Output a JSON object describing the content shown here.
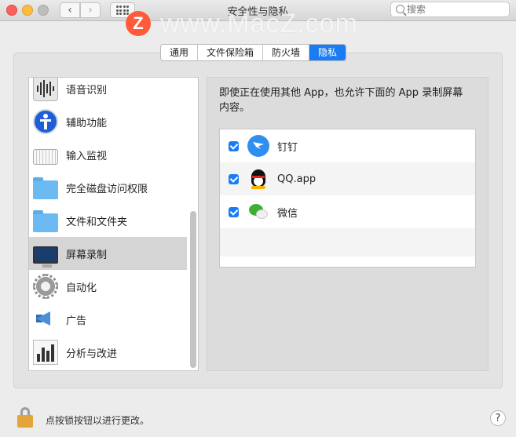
{
  "window": {
    "title": "安全性与隐私",
    "nav_back": "‹",
    "nav_forward": "›"
  },
  "search": {
    "placeholder": "搜索"
  },
  "watermark": {
    "logo": "Z",
    "text": "www.MacZ.com"
  },
  "tabs": [
    {
      "label": "通用",
      "active": false
    },
    {
      "label": "文件保险箱",
      "active": false
    },
    {
      "label": "防火墙",
      "active": false
    },
    {
      "label": "隐私",
      "active": true
    }
  ],
  "sidebar": {
    "items": [
      {
        "label": "语音识别",
        "icon": "speech-recognition-icon"
      },
      {
        "label": "辅助功能",
        "icon": "accessibility-icon"
      },
      {
        "label": "输入监视",
        "icon": "keyboard-icon"
      },
      {
        "label": "完全磁盘访问权限",
        "icon": "folder-icon"
      },
      {
        "label": "文件和文件夹",
        "icon": "folder-icon"
      },
      {
        "label": "屏幕录制",
        "icon": "monitor-icon",
        "selected": true
      },
      {
        "label": "自动化",
        "icon": "gear-icon"
      },
      {
        "label": "广告",
        "icon": "megaphone-icon"
      },
      {
        "label": "分析与改进",
        "icon": "chart-icon"
      }
    ]
  },
  "main": {
    "description": "即使正在使用其他 App，也允许下面的 App 录制屏幕内容。",
    "apps": [
      {
        "label": "钉钉",
        "checked": true,
        "icon": "dingtalk-icon"
      },
      {
        "label": "QQ.app",
        "checked": true,
        "icon": "qq-icon"
      },
      {
        "label": "微信",
        "checked": true,
        "icon": "wechat-icon"
      }
    ]
  },
  "footer": {
    "lock_text": "点按锁按钮以进行更改。",
    "help": "?"
  },
  "colors": {
    "accent": "#1a7cf4",
    "window_bg": "#ececec",
    "lock": "#e3a53a"
  }
}
